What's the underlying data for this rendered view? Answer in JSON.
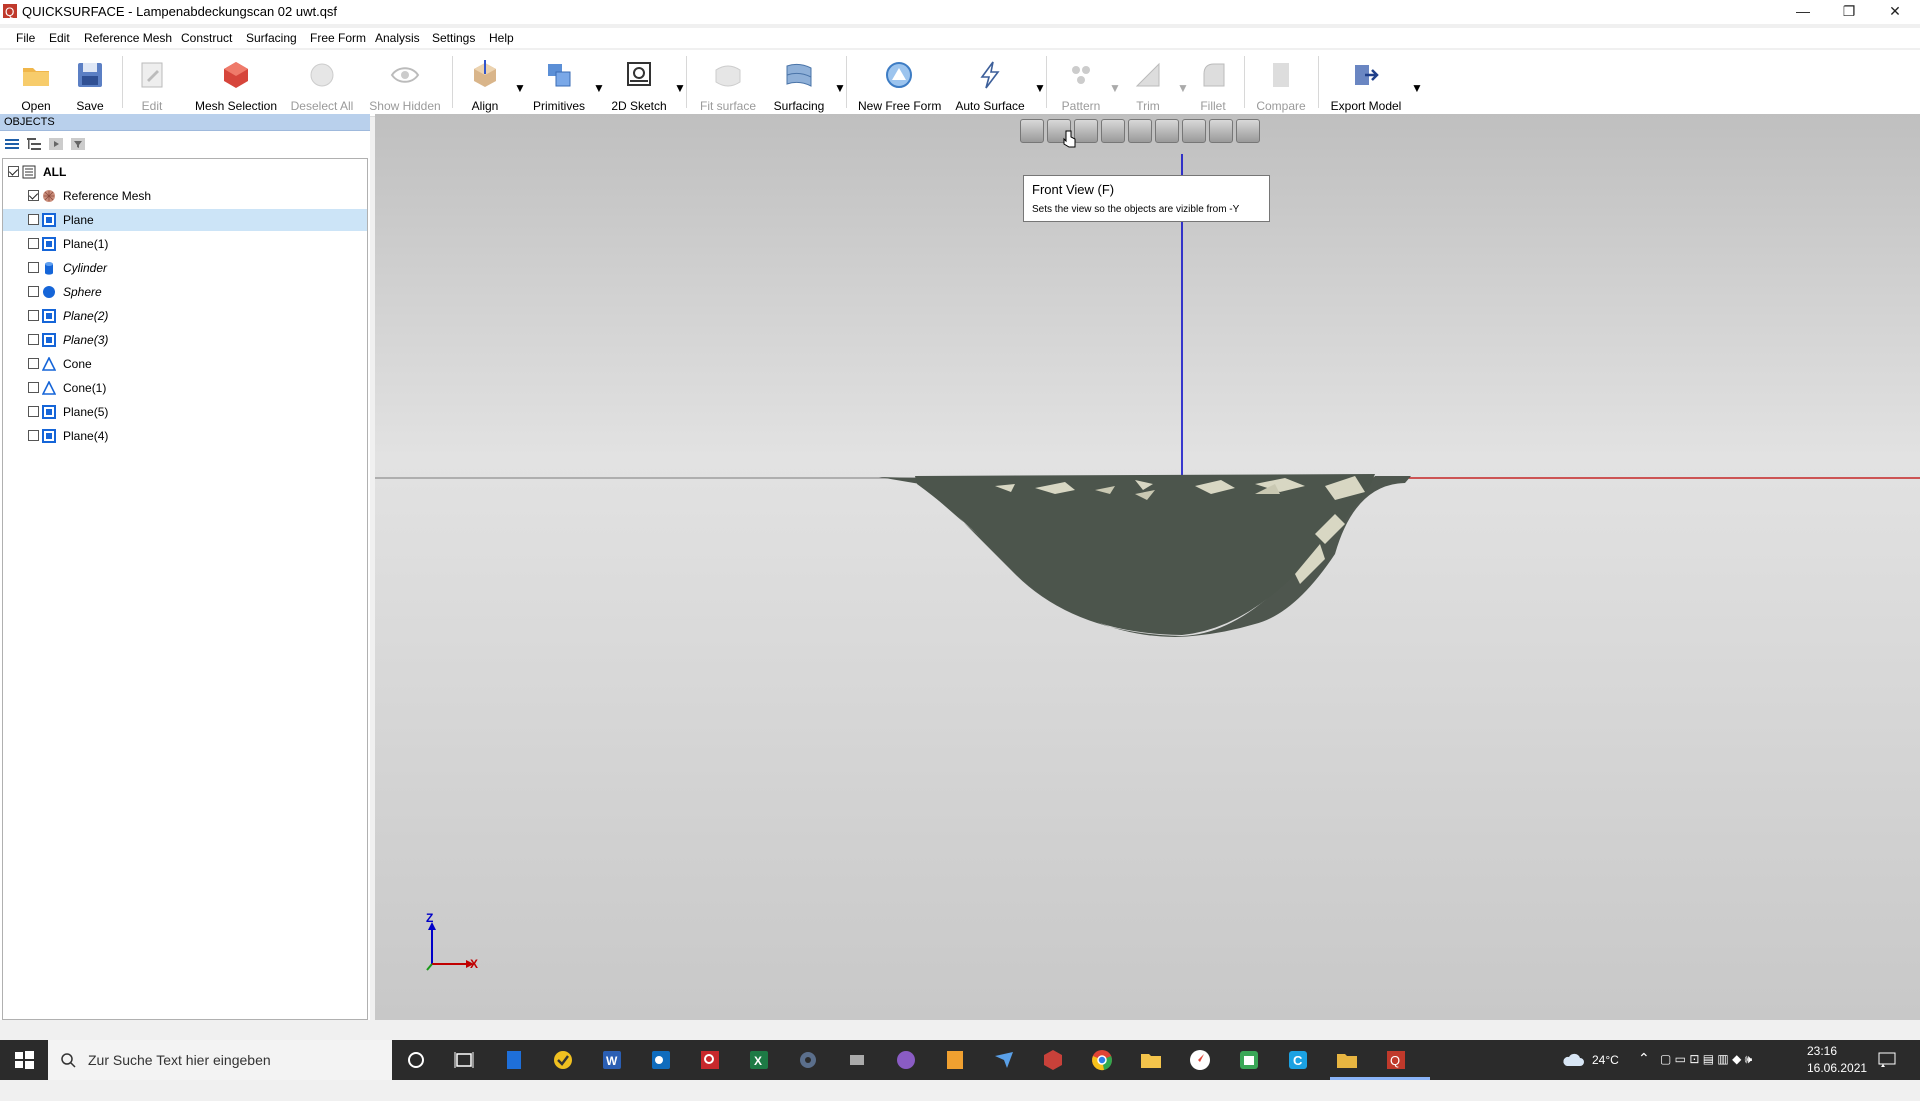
{
  "window": {
    "title": "QUICKSURFACE - Lampenabdeckungscan 02 uwt.qsf",
    "minimize": "—",
    "restore": "❐",
    "close": "✕"
  },
  "menu": [
    "File",
    "Edit",
    "Reference Mesh",
    "Construct",
    "Surfacing",
    "Free Form",
    "Analysis",
    "Settings",
    "Help"
  ],
  "toolbar": {
    "open": "Open",
    "save": "Save",
    "edit": "Edit",
    "mesh_selection": "Mesh Selection",
    "deselect_all": "Deselect All",
    "show_hidden": "Show Hidden",
    "align": "Align",
    "primitives": "Primitives",
    "sketch_2d": "2D Sketch",
    "fit_surface": "Fit surface",
    "surfacing": "Surfacing",
    "new_free_form": "New Free Form",
    "auto_surface": "Auto Surface",
    "pattern": "Pattern",
    "trim": "Trim",
    "fillet": "Fillet",
    "compare": "Compare",
    "export_model": "Export Model"
  },
  "objects_panel": {
    "header": "OBJECTS",
    "all_label": "ALL",
    "items": [
      {
        "label": "Reference Mesh",
        "checked": true,
        "icon": "mesh-icon",
        "italic": false
      },
      {
        "label": "Plane",
        "checked": false,
        "icon": "plane-icon",
        "italic": false,
        "selected": true
      },
      {
        "label": "Plane(1)",
        "checked": false,
        "icon": "plane-icon",
        "italic": false
      },
      {
        "label": "Cylinder",
        "checked": false,
        "icon": "cylinder-icon",
        "italic": true
      },
      {
        "label": "Sphere",
        "checked": false,
        "icon": "sphere-icon",
        "italic": true
      },
      {
        "label": "Plane(2)",
        "checked": false,
        "icon": "plane-icon",
        "italic": true
      },
      {
        "label": "Plane(3)",
        "checked": false,
        "icon": "plane-icon",
        "italic": true
      },
      {
        "label": "Cone",
        "checked": false,
        "icon": "cone-icon",
        "italic": false
      },
      {
        "label": "Cone(1)",
        "checked": false,
        "icon": "cone-icon",
        "italic": false
      },
      {
        "label": "Plane(5)",
        "checked": false,
        "icon": "plane-icon",
        "italic": false
      },
      {
        "label": "Plane(4)",
        "checked": false,
        "icon": "plane-icon",
        "italic": false
      }
    ]
  },
  "viewport": {
    "tooltip_title": "Front View    (F)",
    "tooltip_desc": "Sets the view so the objects are vizible from -Y",
    "axis_z": "Z",
    "axis_x": "X",
    "accent_blue": "#0000c8",
    "accent_red": "#c00000"
  },
  "taskbar": {
    "search_placeholder": "Zur Suche Text hier eingeben",
    "temperature": "24°C",
    "time": "23:16",
    "date": "16.06.2021"
  }
}
